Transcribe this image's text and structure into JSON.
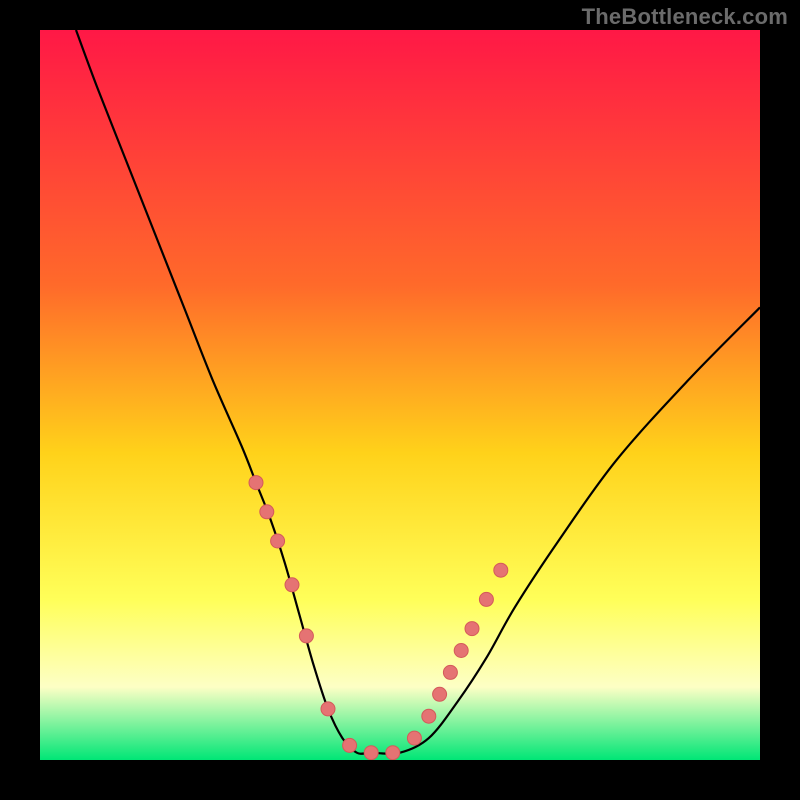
{
  "attribution": "TheBottleneck.com",
  "colors": {
    "background": "#000000",
    "gradient_top": "#ff1846",
    "gradient_mid1": "#ff6a2a",
    "gradient_mid2": "#ffd21a",
    "gradient_mid3": "#ffff59",
    "gradient_mid4": "#fdffc5",
    "gradient_bottom": "#00e676",
    "curve": "#000000",
    "marker_fill": "#e57373",
    "marker_stroke": "#d45a5a"
  },
  "chart_data": {
    "type": "line",
    "title": "",
    "xlabel": "",
    "ylabel": "",
    "xlim": [
      0,
      100
    ],
    "ylim": [
      0,
      100
    ],
    "series": [
      {
        "name": "bottleneck-curve",
        "x": [
          5,
          8,
          12,
          16,
          20,
          24,
          28,
          30,
          32,
          34,
          36,
          38,
          40,
          42,
          44,
          46,
          50,
          54,
          58,
          62,
          66,
          72,
          80,
          90,
          100
        ],
        "values": [
          100,
          92,
          82,
          72,
          62,
          52,
          43,
          38,
          33,
          27,
          20,
          13,
          7,
          3,
          1,
          1,
          1,
          3,
          8,
          14,
          21,
          30,
          41,
          52,
          62
        ]
      }
    ],
    "markers": {
      "name": "highlight-points",
      "x": [
        30,
        31.5,
        33,
        35,
        37,
        40,
        43,
        46,
        49,
        52,
        54,
        55.5,
        57,
        58.5,
        60,
        62,
        64
      ],
      "values": [
        38,
        34,
        30,
        24,
        17,
        7,
        2,
        1,
        1,
        3,
        6,
        9,
        12,
        15,
        18,
        22,
        26
      ]
    }
  }
}
